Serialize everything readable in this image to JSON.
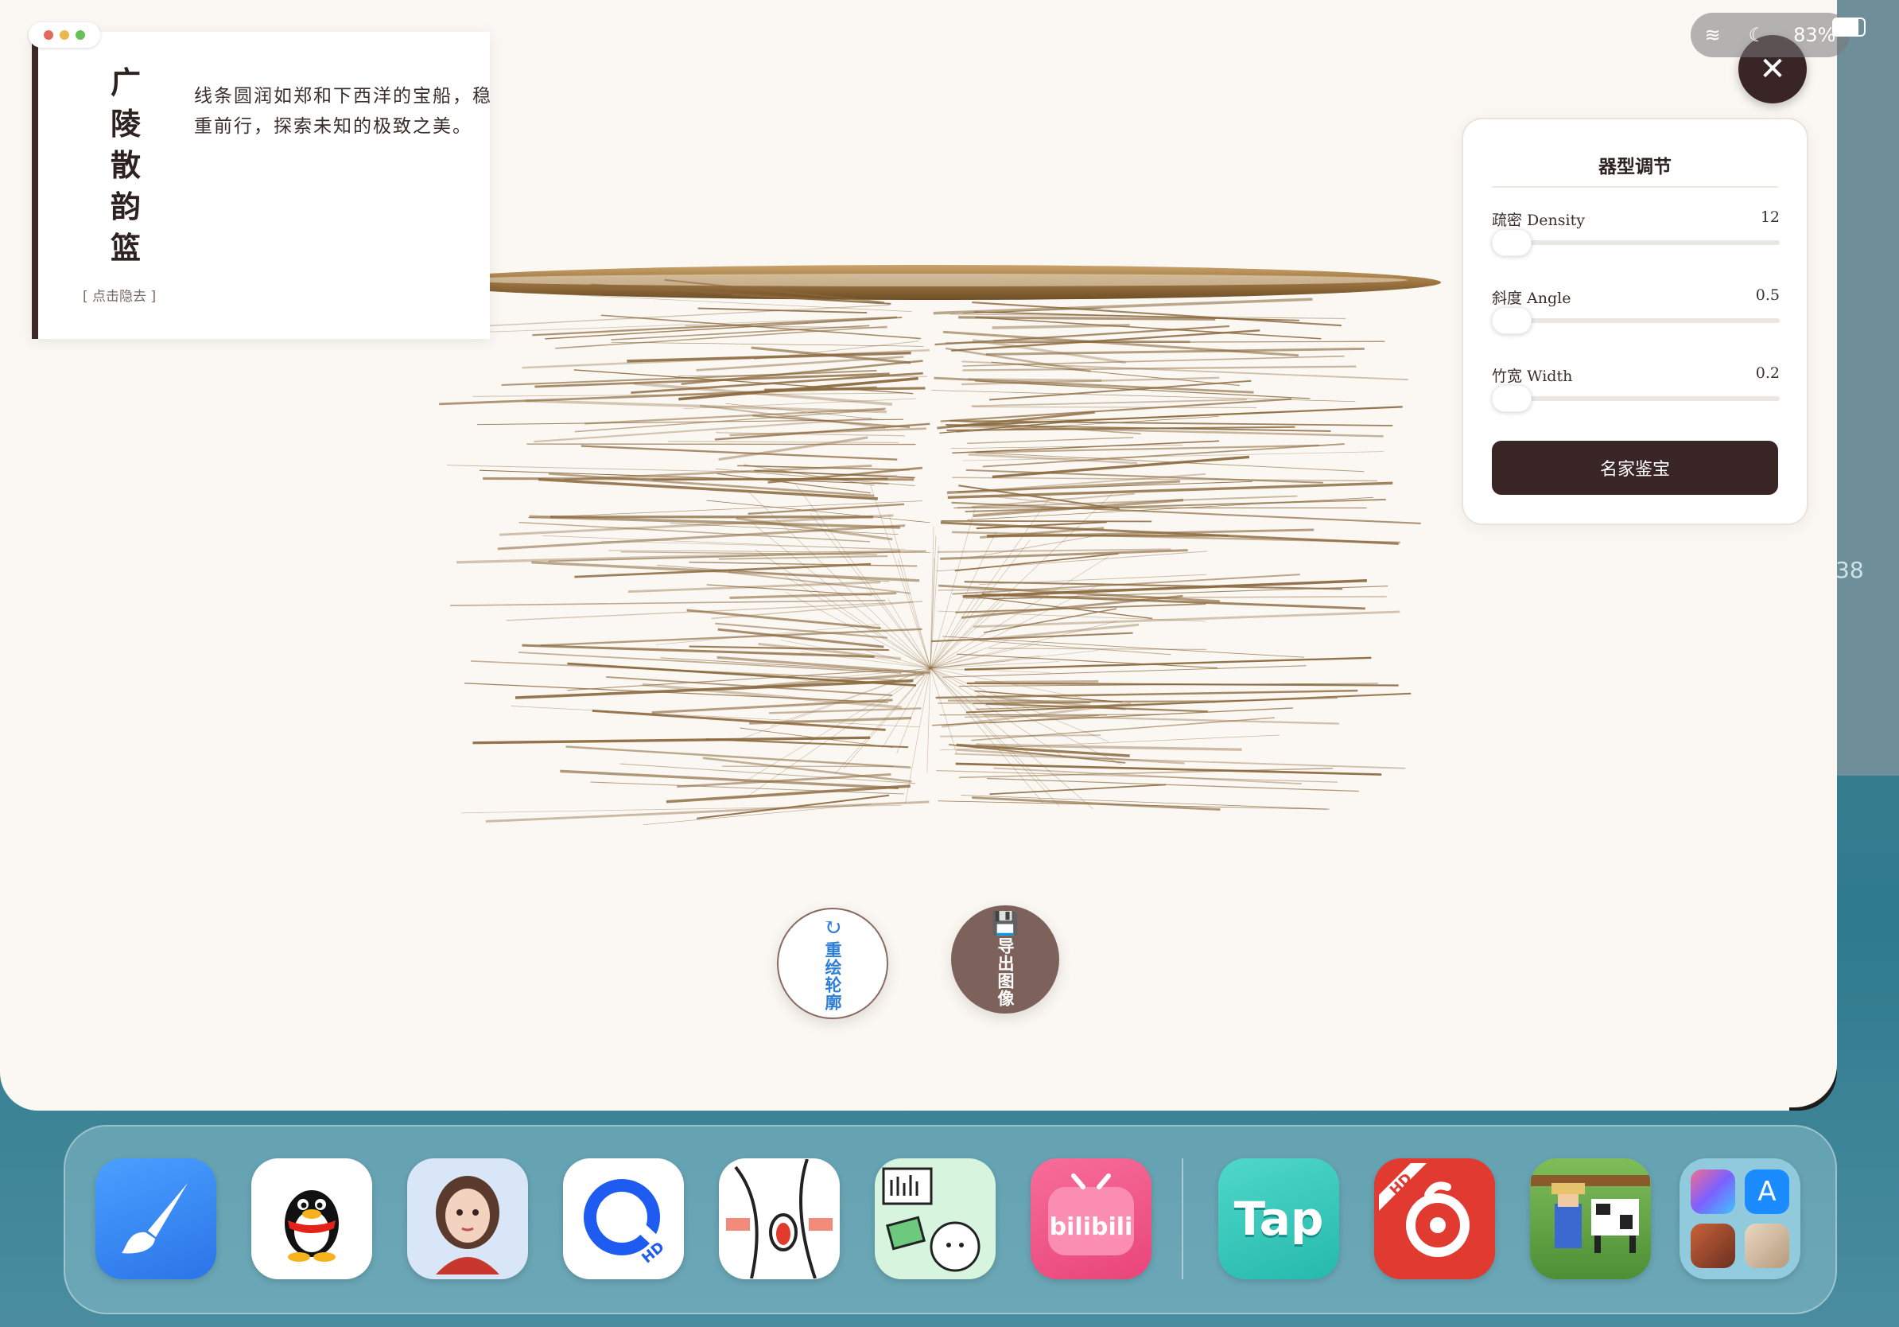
{
  "status_bar": {
    "battery": "83%"
  },
  "intro": {
    "title_chars": [
      "广",
      "陵",
      "散",
      "韵",
      "篮"
    ],
    "description": "线条圆润如郑和下西洋的宝船，稳重前行，探索未知的极致之美。",
    "hide_label": "[ 点击隐去 ]"
  },
  "panel": {
    "title": "器型调节",
    "sliders": [
      {
        "label": "疏密 Density",
        "value": "12",
        "fraction": 0.0
      },
      {
        "label": "斜度 Angle",
        "value": "0.5",
        "fraction": 0.0
      },
      {
        "label": "竹宽 Width",
        "value": "0.2",
        "fraction": 0.0
      }
    ],
    "button_label": "名家鉴宝"
  },
  "actions": {
    "redraw_label": "重绘轮廓",
    "export_label": "导出图像"
  },
  "close_icon": "close-icon",
  "colors": {
    "accent_dark": "#3a2526",
    "bamboo": "#8c6a3f",
    "window_bg": "#fbf8f3"
  },
  "dock": {
    "apps": [
      "paint-brush-app",
      "qq-app",
      "avatar-app",
      "hd-browser-app",
      "anime-art-app",
      "sticker-app",
      "bilibili-app",
      "taptap-app",
      "netease-music-app",
      "farm-game-app",
      "app-library-folder"
    ],
    "text": {
      "bilibili": "bilibili",
      "tap": "Tap",
      "hd": "HD"
    }
  }
}
